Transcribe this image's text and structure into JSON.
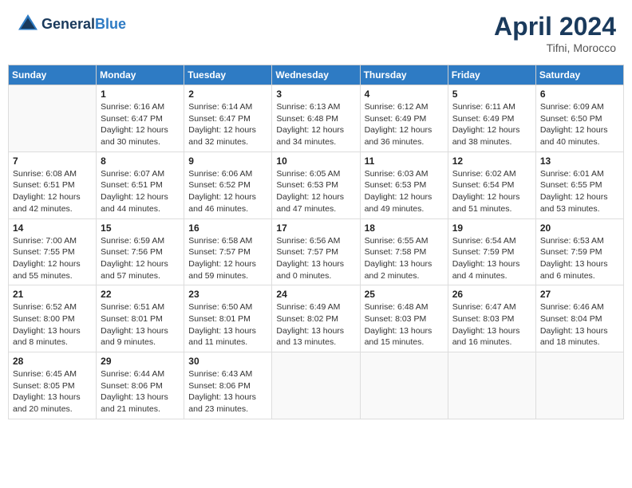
{
  "header": {
    "logo_general": "General",
    "logo_blue": "Blue",
    "month_title": "April 2024",
    "location": "Tifni, Morocco"
  },
  "days_of_week": [
    "Sunday",
    "Monday",
    "Tuesday",
    "Wednesday",
    "Thursday",
    "Friday",
    "Saturday"
  ],
  "weeks": [
    [
      {
        "day": "",
        "sunrise": "",
        "sunset": "",
        "daylight": ""
      },
      {
        "day": "1",
        "sunrise": "Sunrise: 6:16 AM",
        "sunset": "Sunset: 6:47 PM",
        "daylight": "Daylight: 12 hours and 30 minutes."
      },
      {
        "day": "2",
        "sunrise": "Sunrise: 6:14 AM",
        "sunset": "Sunset: 6:47 PM",
        "daylight": "Daylight: 12 hours and 32 minutes."
      },
      {
        "day": "3",
        "sunrise": "Sunrise: 6:13 AM",
        "sunset": "Sunset: 6:48 PM",
        "daylight": "Daylight: 12 hours and 34 minutes."
      },
      {
        "day": "4",
        "sunrise": "Sunrise: 6:12 AM",
        "sunset": "Sunset: 6:49 PM",
        "daylight": "Daylight: 12 hours and 36 minutes."
      },
      {
        "day": "5",
        "sunrise": "Sunrise: 6:11 AM",
        "sunset": "Sunset: 6:49 PM",
        "daylight": "Daylight: 12 hours and 38 minutes."
      },
      {
        "day": "6",
        "sunrise": "Sunrise: 6:09 AM",
        "sunset": "Sunset: 6:50 PM",
        "daylight": "Daylight: 12 hours and 40 minutes."
      }
    ],
    [
      {
        "day": "7",
        "sunrise": "Sunrise: 6:08 AM",
        "sunset": "Sunset: 6:51 PM",
        "daylight": "Daylight: 12 hours and 42 minutes."
      },
      {
        "day": "8",
        "sunrise": "Sunrise: 6:07 AM",
        "sunset": "Sunset: 6:51 PM",
        "daylight": "Daylight: 12 hours and 44 minutes."
      },
      {
        "day": "9",
        "sunrise": "Sunrise: 6:06 AM",
        "sunset": "Sunset: 6:52 PM",
        "daylight": "Daylight: 12 hours and 46 minutes."
      },
      {
        "day": "10",
        "sunrise": "Sunrise: 6:05 AM",
        "sunset": "Sunset: 6:53 PM",
        "daylight": "Daylight: 12 hours and 47 minutes."
      },
      {
        "day": "11",
        "sunrise": "Sunrise: 6:03 AM",
        "sunset": "Sunset: 6:53 PM",
        "daylight": "Daylight: 12 hours and 49 minutes."
      },
      {
        "day": "12",
        "sunrise": "Sunrise: 6:02 AM",
        "sunset": "Sunset: 6:54 PM",
        "daylight": "Daylight: 12 hours and 51 minutes."
      },
      {
        "day": "13",
        "sunrise": "Sunrise: 6:01 AM",
        "sunset": "Sunset: 6:55 PM",
        "daylight": "Daylight: 12 hours and 53 minutes."
      }
    ],
    [
      {
        "day": "14",
        "sunrise": "Sunrise: 7:00 AM",
        "sunset": "Sunset: 7:55 PM",
        "daylight": "Daylight: 12 hours and 55 minutes."
      },
      {
        "day": "15",
        "sunrise": "Sunrise: 6:59 AM",
        "sunset": "Sunset: 7:56 PM",
        "daylight": "Daylight: 12 hours and 57 minutes."
      },
      {
        "day": "16",
        "sunrise": "Sunrise: 6:58 AM",
        "sunset": "Sunset: 7:57 PM",
        "daylight": "Daylight: 12 hours and 59 minutes."
      },
      {
        "day": "17",
        "sunrise": "Sunrise: 6:56 AM",
        "sunset": "Sunset: 7:57 PM",
        "daylight": "Daylight: 13 hours and 0 minutes."
      },
      {
        "day": "18",
        "sunrise": "Sunrise: 6:55 AM",
        "sunset": "Sunset: 7:58 PM",
        "daylight": "Daylight: 13 hours and 2 minutes."
      },
      {
        "day": "19",
        "sunrise": "Sunrise: 6:54 AM",
        "sunset": "Sunset: 7:59 PM",
        "daylight": "Daylight: 13 hours and 4 minutes."
      },
      {
        "day": "20",
        "sunrise": "Sunrise: 6:53 AM",
        "sunset": "Sunset: 7:59 PM",
        "daylight": "Daylight: 13 hours and 6 minutes."
      }
    ],
    [
      {
        "day": "21",
        "sunrise": "Sunrise: 6:52 AM",
        "sunset": "Sunset: 8:00 PM",
        "daylight": "Daylight: 13 hours and 8 minutes."
      },
      {
        "day": "22",
        "sunrise": "Sunrise: 6:51 AM",
        "sunset": "Sunset: 8:01 PM",
        "daylight": "Daylight: 13 hours and 9 minutes."
      },
      {
        "day": "23",
        "sunrise": "Sunrise: 6:50 AM",
        "sunset": "Sunset: 8:01 PM",
        "daylight": "Daylight: 13 hours and 11 minutes."
      },
      {
        "day": "24",
        "sunrise": "Sunrise: 6:49 AM",
        "sunset": "Sunset: 8:02 PM",
        "daylight": "Daylight: 13 hours and 13 minutes."
      },
      {
        "day": "25",
        "sunrise": "Sunrise: 6:48 AM",
        "sunset": "Sunset: 8:03 PM",
        "daylight": "Daylight: 13 hours and 15 minutes."
      },
      {
        "day": "26",
        "sunrise": "Sunrise: 6:47 AM",
        "sunset": "Sunset: 8:03 PM",
        "daylight": "Daylight: 13 hours and 16 minutes."
      },
      {
        "day": "27",
        "sunrise": "Sunrise: 6:46 AM",
        "sunset": "Sunset: 8:04 PM",
        "daylight": "Daylight: 13 hours and 18 minutes."
      }
    ],
    [
      {
        "day": "28",
        "sunrise": "Sunrise: 6:45 AM",
        "sunset": "Sunset: 8:05 PM",
        "daylight": "Daylight: 13 hours and 20 minutes."
      },
      {
        "day": "29",
        "sunrise": "Sunrise: 6:44 AM",
        "sunset": "Sunset: 8:06 PM",
        "daylight": "Daylight: 13 hours and 21 minutes."
      },
      {
        "day": "30",
        "sunrise": "Sunrise: 6:43 AM",
        "sunset": "Sunset: 8:06 PM",
        "daylight": "Daylight: 13 hours and 23 minutes."
      },
      {
        "day": "",
        "sunrise": "",
        "sunset": "",
        "daylight": ""
      },
      {
        "day": "",
        "sunrise": "",
        "sunset": "",
        "daylight": ""
      },
      {
        "day": "",
        "sunrise": "",
        "sunset": "",
        "daylight": ""
      },
      {
        "day": "",
        "sunrise": "",
        "sunset": "",
        "daylight": ""
      }
    ]
  ]
}
